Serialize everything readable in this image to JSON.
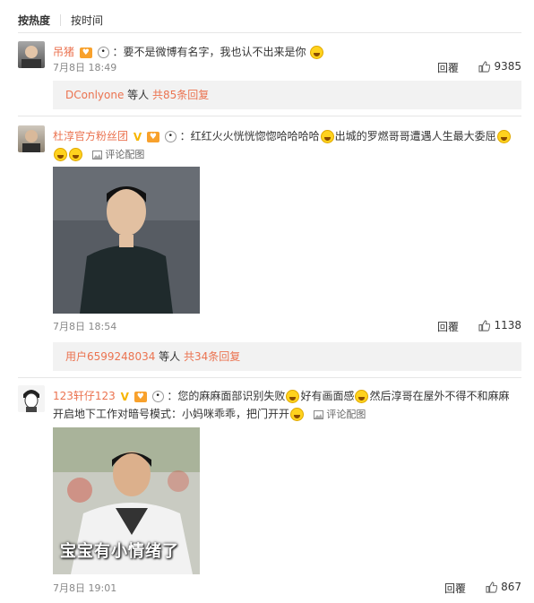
{
  "sort": {
    "hot": "按热度",
    "time": "按时间"
  },
  "comments": [
    {
      "user": "吊猪",
      "text_parts": [
        "：要不是微博有名字，我也认不出来是你"
      ],
      "time": "7月8日 18:49",
      "reply": "回覆",
      "likes": "9385"
    },
    {
      "user": "杜淳官方粉丝团",
      "text_parts": [
        "：红红火火恍恍惚惚哈哈哈哈",
        "出城的罗燃哥哥遭遇人生最大委屈"
      ],
      "view_pic": "评论配图",
      "time": "7月8日 18:54",
      "reply": "回覆",
      "likes": "1138"
    },
    {
      "user": "123轩仔123",
      "text_parts": [
        "：您的麻麻面部识别失败",
        "好有画面感",
        "然后淳哥在屋外不得不和麻麻开启地下工作对暗号模式：小妈咪乖乖，把门开开"
      ],
      "view_pic": "评论配图",
      "photo_caption": "宝宝有小情绪了",
      "time": "7月8日 19:01",
      "reply": "回覆",
      "likes": "867"
    }
  ],
  "subreplies": [
    {
      "user": "DConlyone",
      "suffix": " 等人 ",
      "count": "共85条回复"
    },
    {
      "user": "用户6599248034",
      "suffix": " 等人 ",
      "count": "共34条回复"
    }
  ],
  "colors": {
    "link": "#eb7350",
    "accent_badge": "#f8a12c"
  }
}
